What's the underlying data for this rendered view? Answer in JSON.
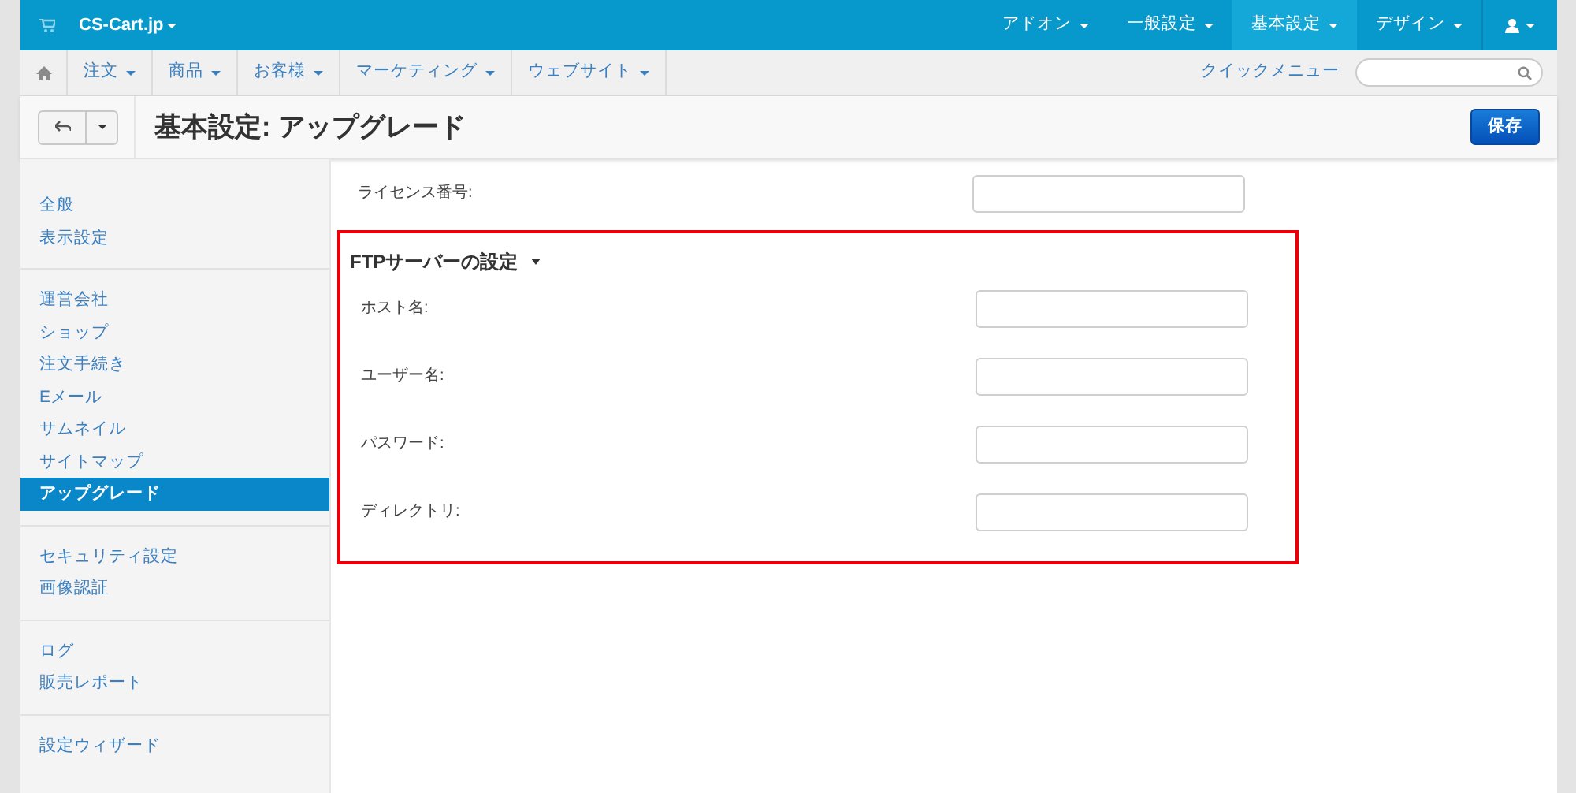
{
  "top_bar": {
    "brand": "CS-Cart.jp",
    "menu": [
      {
        "label": "アドオン",
        "selected": false
      },
      {
        "label": "一般設定",
        "selected": false
      },
      {
        "label": "基本設定",
        "selected": true
      },
      {
        "label": "デザイン",
        "selected": false
      }
    ]
  },
  "nav_bar": {
    "items": [
      "注文",
      "商品",
      "お客様",
      "マーケティング",
      "ウェブサイト"
    ],
    "quick_menu": "クイックメニュー"
  },
  "title_bar": {
    "title": "基本設定: アップグレード",
    "save_button": "保存"
  },
  "sidebar": {
    "groups": [
      {
        "items": [
          {
            "label": "全般",
            "selected": false
          },
          {
            "label": "表示設定",
            "selected": false
          }
        ]
      },
      {
        "items": [
          {
            "label": "運営会社",
            "selected": false
          },
          {
            "label": "ショップ",
            "selected": false
          },
          {
            "label": "注文手続き",
            "selected": false
          },
          {
            "label": "Eメール",
            "selected": false
          },
          {
            "label": "サムネイル",
            "selected": false
          },
          {
            "label": "サイトマップ",
            "selected": false
          },
          {
            "label": "アップグレード",
            "selected": true
          }
        ]
      },
      {
        "items": [
          {
            "label": "セキュリティ設定",
            "selected": false
          },
          {
            "label": "画像認証",
            "selected": false
          }
        ]
      },
      {
        "items": [
          {
            "label": "ログ",
            "selected": false
          },
          {
            "label": "販売レポート",
            "selected": false
          }
        ]
      },
      {
        "items": [
          {
            "label": "設定ウィザード",
            "selected": false
          }
        ]
      }
    ]
  },
  "form": {
    "fields": [
      {
        "label": "ライセンス番号:"
      }
    ],
    "section": {
      "title": "FTPサーバーの設定",
      "expanded": true,
      "highlighted": true,
      "fields": [
        {
          "label": "ホスト名:"
        },
        {
          "label": "ユーザー名:"
        },
        {
          "label": "パスワード:"
        },
        {
          "label": "ディレクトリ:"
        }
      ]
    }
  }
}
